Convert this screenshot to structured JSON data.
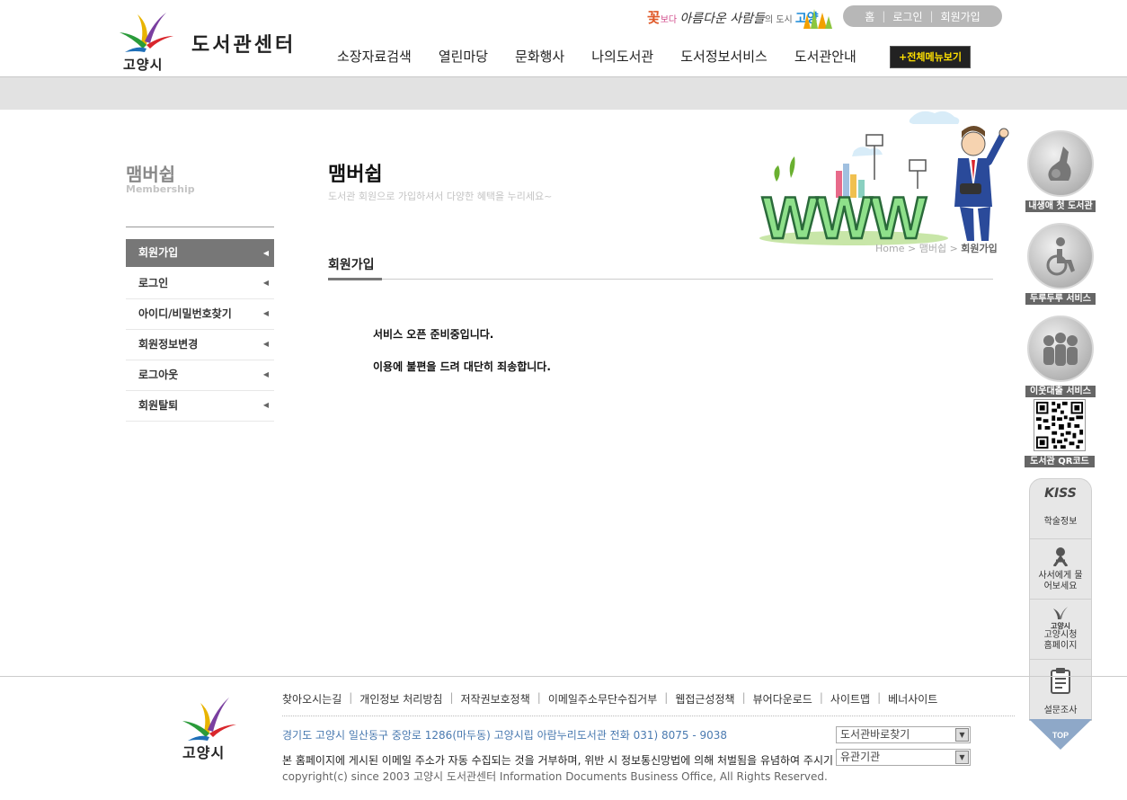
{
  "header": {
    "city": "고양시",
    "title": "도서관센터",
    "slogan_parts": [
      "꽃",
      "보다 ",
      "아름다운 사람들",
      "의 도시 ",
      "고양"
    ],
    "util": [
      "홈",
      "로그인",
      "회원가입"
    ],
    "nav": [
      "소장자료검색",
      "열린마당",
      "문화행사",
      "나의도서관",
      "도서정보서비스",
      "도서관안내"
    ],
    "all_menu": "+전체메뉴보기"
  },
  "sidebar": {
    "title": "맴버쉽",
    "subtitle": "Membership",
    "items": [
      {
        "label": "회원가입",
        "active": true
      },
      {
        "label": "로그인"
      },
      {
        "label": "아이디/비밀번호찾기"
      },
      {
        "label": "회원정보변경"
      },
      {
        "label": "로그아웃"
      },
      {
        "label": "회원탈퇴"
      }
    ]
  },
  "main": {
    "title": "맴버쉽",
    "desc": "도서관 회원으로 가입하셔서 다양한 혜택을 누리세요~",
    "banner_text": "WWW",
    "breadcrumb": [
      "Home",
      "맴버쉽",
      "회원가입"
    ],
    "section_title": "회원가입",
    "messages": [
      "서비스 오픈 준비중입니다.",
      "이용에 불편을 드려 대단히 죄송합니다."
    ]
  },
  "quick_links": [
    {
      "label": "내생애 첫 도서관",
      "icon": "kangaroo-icon"
    },
    {
      "label": "두루두루 서비스",
      "icon": "wheelchair-icon"
    },
    {
      "label": "이웃대출 서비스",
      "icon": "people-icon"
    }
  ],
  "qr": {
    "label": "도서관 QR코드"
  },
  "quick_menu": [
    {
      "icon_text": "KISS",
      "label": "학술정보"
    },
    {
      "icon_text": "",
      "label": "사서에게 물어보세요"
    },
    {
      "icon_text": "고양시",
      "label": "고양시청 홈페이지"
    },
    {
      "icon_text": "",
      "label": "설문조사"
    }
  ],
  "top_label": "TOP",
  "footer": {
    "city": "고양시",
    "menu": [
      "찾아오시는길",
      "개인정보 처리방침",
      "저작권보호정책",
      "이메일주소무단수집거부",
      "웹접근성정책",
      "뷰어다운로드",
      "사이트맵",
      "베너사이트"
    ],
    "address": "경기도 고양시 일산동구 중앙로 1286(마두동) 고양시립 아람누리도서관 전화 031) 8075 - 9038",
    "notice": "본 홈페이지에 게시된 이메일 주소가 자동 수집되는 것을 거부하며, 위반 시 정보통신망법에 의해 처벌됨을 유념하여 주시기 바랍니다.",
    "copyright": "copyright(c) since 2003 고양시 도서관센터 Information Documents Business Office, All Rights Reserved.",
    "select1": "도서관바로찾기",
    "select2": "유관기관"
  },
  "colors": {
    "accent": "#ffe000",
    "band": "#e2e2e2",
    "active_menu": "#777777",
    "address": "#4a7ab0"
  }
}
